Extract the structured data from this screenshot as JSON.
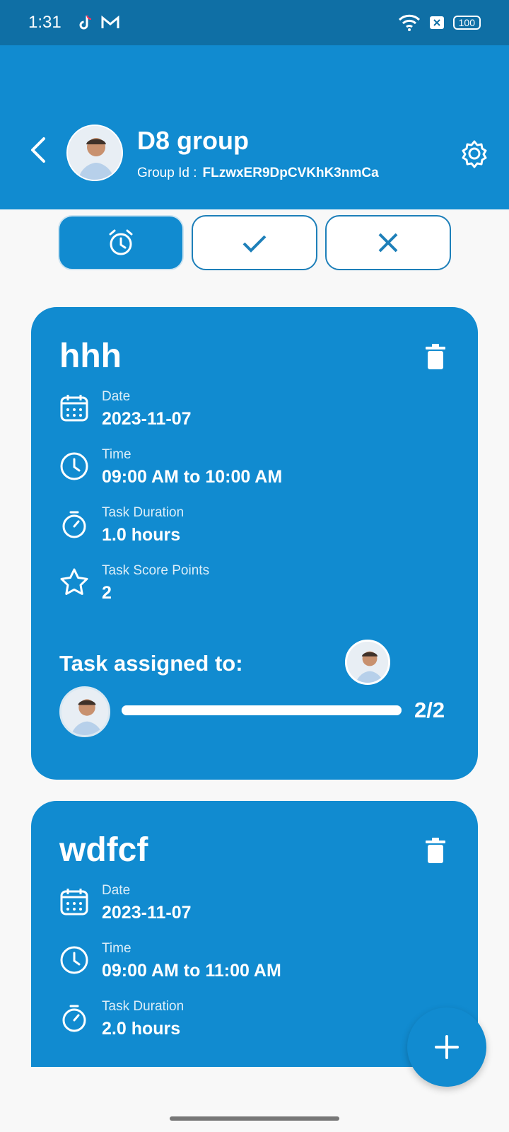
{
  "status_bar": {
    "time": "1:31",
    "battery": "100",
    "icons": [
      "tiktok-icon",
      "gmail-icon",
      "wifi-icon",
      "close-box-icon",
      "battery-icon"
    ]
  },
  "header": {
    "group_name": "D8 group",
    "group_id_label": "Group Id :",
    "group_id_value": "FLzwxER9DpCVKhK3nmCa",
    "icons": [
      "back-icon",
      "settings-icon"
    ]
  },
  "filters": {
    "active": "pending",
    "items": [
      {
        "key": "pending",
        "icon": "alarm-icon"
      },
      {
        "key": "completed",
        "icon": "check-icon"
      },
      {
        "key": "rejected",
        "icon": "close-icon"
      }
    ]
  },
  "tasks": [
    {
      "title": "hhh",
      "date_label": "Date",
      "date_value": "2023-11-07",
      "time_label": "Time",
      "time_value": "09:00 AM to 10:00 AM",
      "duration_label": "Task Duration",
      "duration_value": "1.0 hours",
      "points_label": "Task Score Points",
      "points_value": "2",
      "assigned_label": "Task assigned to:",
      "progress_text": "2/2",
      "progress_fraction": 1.0
    },
    {
      "title": "wdfcf",
      "date_label": "Date",
      "date_value": "2023-11-07",
      "time_label": "Time",
      "time_value": "09:00 AM to 11:00 AM",
      "duration_label": "Task Duration",
      "duration_value": "2.0 hours"
    }
  ],
  "colors": {
    "primary": "#118bd0",
    "status_bar": "#0f6fa5",
    "background": "#f8f8f8",
    "filter_border": "#1d7fb9"
  }
}
